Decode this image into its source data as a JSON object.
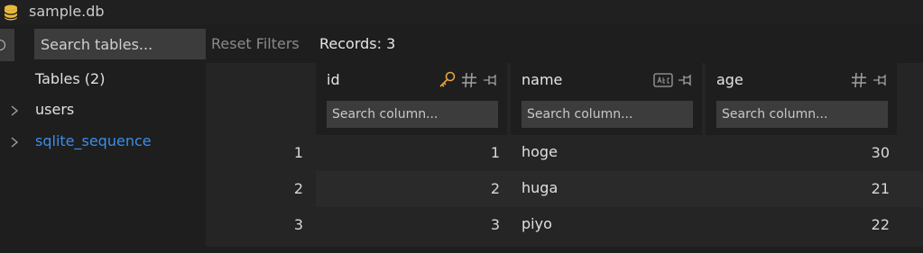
{
  "window": {
    "title": "sample.db"
  },
  "sidebar": {
    "search_placeholder": "Search tables...",
    "tables_heading": "Tables (2)",
    "tables": [
      {
        "label": "users"
      },
      {
        "label": "sqlite_sequence"
      }
    ]
  },
  "toolbar": {
    "reset_filters": "Reset Filters",
    "records": "Records: 3"
  },
  "grid": {
    "columns": [
      {
        "name": "id",
        "search_placeholder": "Search column..."
      },
      {
        "name": "name",
        "search_placeholder": "Search column..."
      },
      {
        "name": "age",
        "search_placeholder": "Search column..."
      }
    ],
    "rows": [
      {
        "num": "1",
        "id": "1",
        "name": "hoge",
        "age": "30"
      },
      {
        "num": "2",
        "id": "2",
        "name": "huga",
        "age": "21"
      },
      {
        "num": "3",
        "id": "3",
        "name": "piyo",
        "age": "22"
      }
    ]
  },
  "colors": {
    "accent_link": "#3b8eea",
    "key_icon": "#e8a33d",
    "db_icon": "#e8b93a"
  }
}
